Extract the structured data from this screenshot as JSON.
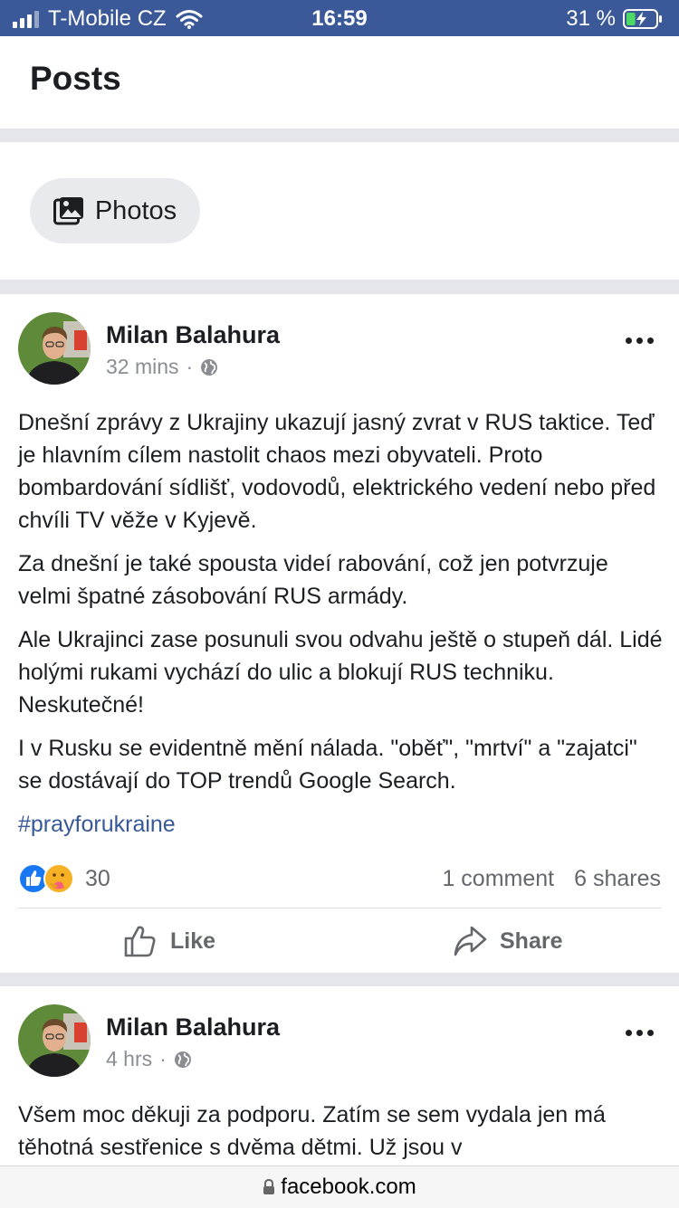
{
  "status_bar": {
    "carrier": "T-Mobile CZ",
    "time": "16:59",
    "battery": "31 %",
    "battery_level": 0.31
  },
  "header": {
    "title": "Posts"
  },
  "photos_button": {
    "label": "Photos"
  },
  "posts": [
    {
      "author": "Milan Balahura",
      "time": "32 mins",
      "privacy_icon": "globe-icon",
      "paragraphs": [
        "Dnešní zprávy z Ukrajiny ukazují jasný zvrat v RUS taktice. Teď je hlavním cílem nastolit chaos mezi obyvateli. Proto bombardování sídlišť, vodovodů, elektrického vedení nebo před chvíli TV věže v Kyjevě.",
        "Za dnešní je také spousta videí rabování, což jen potvrzuje velmi špatné zásobování RUS armády.",
        "Ale Ukrajinci zase posunuli svou odvahu ještě o stupeň dál. Lidé holými rukami vychází do ulic a blokují RUS techniku. Neskutečné!",
        "I v Rusku se evidentně mění nálada. \"oběť\", \"mrtví\" a \"zajatci\" se dostávají do TOP trendů Google Search."
      ],
      "hashtag": "#prayforukraine",
      "reaction_count": "30",
      "comments": "1 comment",
      "shares": "6 shares",
      "like_label": "Like",
      "share_label": "Share"
    },
    {
      "author": "Milan Balahura",
      "time": "4 hrs",
      "privacy_icon": "globe-icon",
      "text": "Všem moc děkuji za podporu. Zatím se sem vydala jen má těhotná sestřenice s dvěma dětmi. Už jsou v"
    }
  ],
  "url_bar": {
    "domain": "facebook.com"
  },
  "colors": {
    "status_bar": "#3b5998",
    "separator": "#e4e6eb",
    "hashtag": "#385898",
    "muted": "#65676b",
    "like_blue": "#1877f2",
    "care_yellow": "#f7b125"
  }
}
